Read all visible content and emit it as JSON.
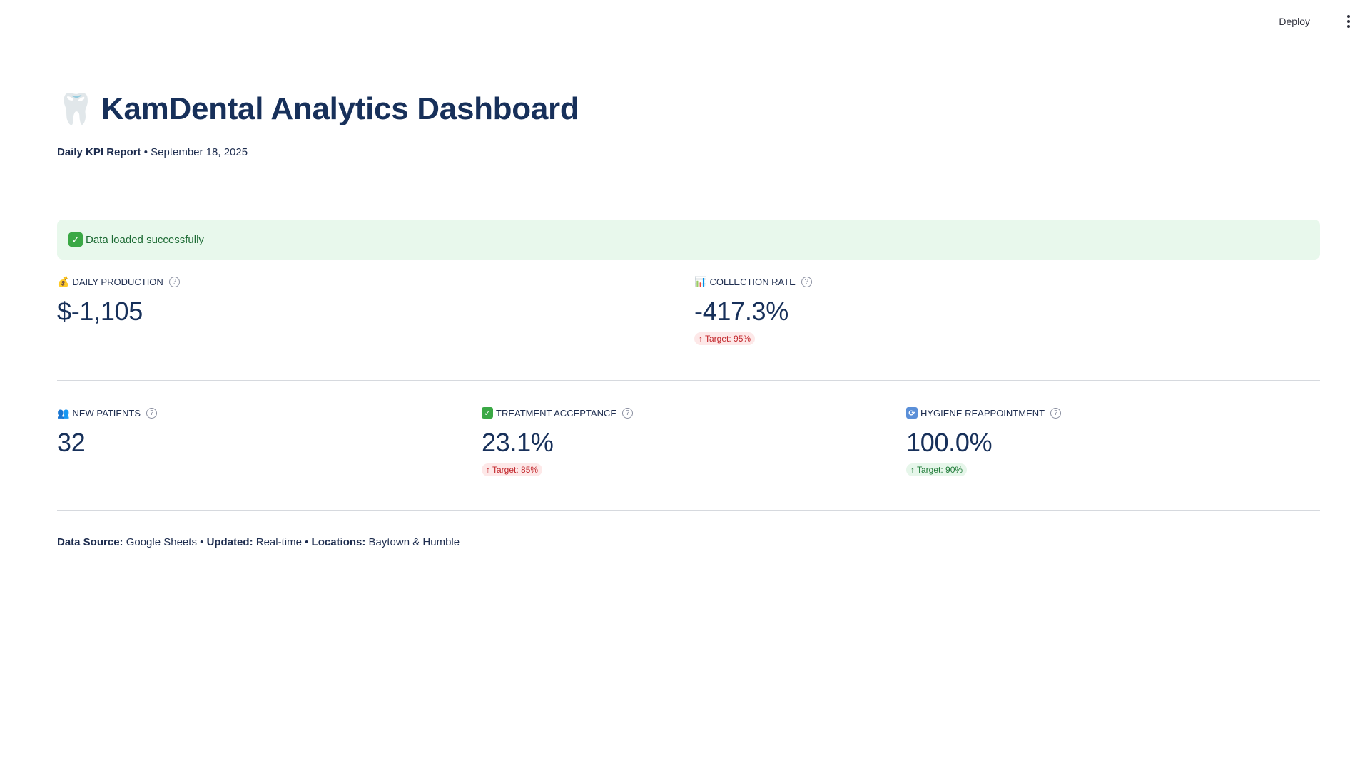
{
  "header": {
    "deploy_label": "Deploy",
    "menu_icon": "vertical-ellipsis-icon"
  },
  "title": {
    "icon": "tooth-icon",
    "text": "KamDental Analytics Dashboard"
  },
  "subtitle": {
    "report_label": "Daily KPI Report",
    "separator": "•",
    "date": "September 18, 2025"
  },
  "alert": {
    "icon": "check-icon",
    "text": "Data loaded successfully",
    "color": "#1d6b34",
    "background": "#e8f8ec"
  },
  "metrics_row1": [
    {
      "icon": "money-bag-icon",
      "label": "DAILY PRODUCTION",
      "value": "$-1,105",
      "delta": null
    },
    {
      "icon": "bar-chart-icon",
      "label": "COLLECTION RATE",
      "value": "-417.3%",
      "delta": {
        "text": "Target: 95%",
        "status": "bad"
      }
    }
  ],
  "metrics_row2": [
    {
      "icon": "people-icon",
      "label": "NEW PATIENTS",
      "value": "32",
      "delta": null
    },
    {
      "icon": "check-icon",
      "label": "TREATMENT ACCEPTANCE",
      "value": "23.1%",
      "delta": {
        "text": "Target: 85%",
        "status": "bad"
      }
    },
    {
      "icon": "refresh-icon",
      "label": "HYGIENE REAPPOINTMENT",
      "value": "100.0%",
      "delta": {
        "text": "Target: 90%",
        "status": "good"
      }
    }
  ],
  "footer": {
    "source_label": "Data Source:",
    "source_value": "Google Sheets",
    "updated_label": "Updated:",
    "updated_value": "Real-time",
    "locations_label": "Locations:",
    "locations_value": "Baytown & Humble",
    "separator": "•"
  },
  "colors": {
    "text_primary": "#17305a",
    "bad": "#c2262b",
    "good": "#1e7a37"
  }
}
